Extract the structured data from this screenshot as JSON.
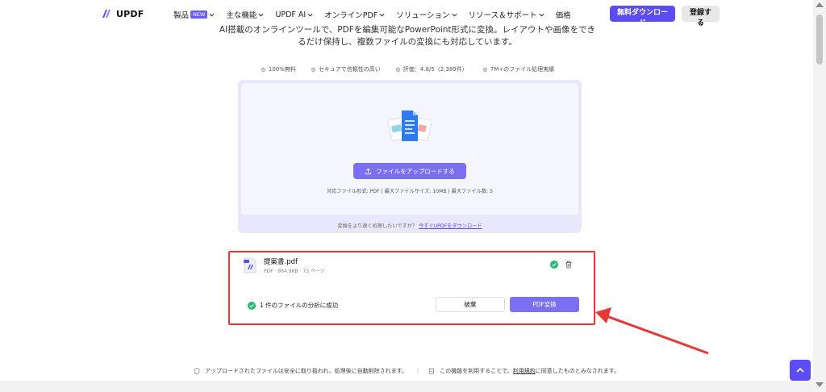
{
  "header": {
    "logo_text": "UPDF",
    "nav": [
      {
        "label": "製品",
        "badge": "NEW"
      },
      {
        "label": "主な機能"
      },
      {
        "label": "UPDF AI"
      },
      {
        "label": "オンラインPDF"
      },
      {
        "label": "ソリューション"
      },
      {
        "label": "リソース＆サポート"
      },
      {
        "label": "価格"
      }
    ],
    "free_download": "無料ダウンロード",
    "login": "登録する"
  },
  "description": {
    "line1": "AI搭載のオンラインツールで、PDFを編集可能なPowerPoint形式に変換。レイアウトや画像をでき",
    "line2": "るだけ保持し、複数ファイルの変換にも対応しています。"
  },
  "features": [
    "100%無料",
    "セキュアで信頼性の高い",
    "評価：4.8/5（2,389件）",
    "7M+のファイル処理実績"
  ],
  "upload": {
    "button": "ファイルをアップロードする",
    "info": "対応ファイル形式: PDF  |  最大ファイルサイズ: 10MB  |  最大ファイル数: 5",
    "hint": "変換をより速く処理したいですか？",
    "hint_link": "今すぐUPDFをダウンロード"
  },
  "file": {
    "name": "提案書.pdf",
    "meta": "PDF · 864.9KB · 73 ページ",
    "success": "1 件のファイルの分析に成功",
    "discard": "破棄",
    "convert": "PDF変換"
  },
  "footer": {
    "note1": "アップロードされたファイルは安全に取り扱われ、処理後に自動削除されます。",
    "note2_pre": "この機能を利用することで、",
    "note2_link": "利用規約",
    "note2_post": "に同意したものとみなされます。"
  },
  "colors": {
    "brand": "#5b4cf5",
    "accent": "#7b70f2",
    "success": "#2bb673",
    "highlight": "#e53935"
  }
}
